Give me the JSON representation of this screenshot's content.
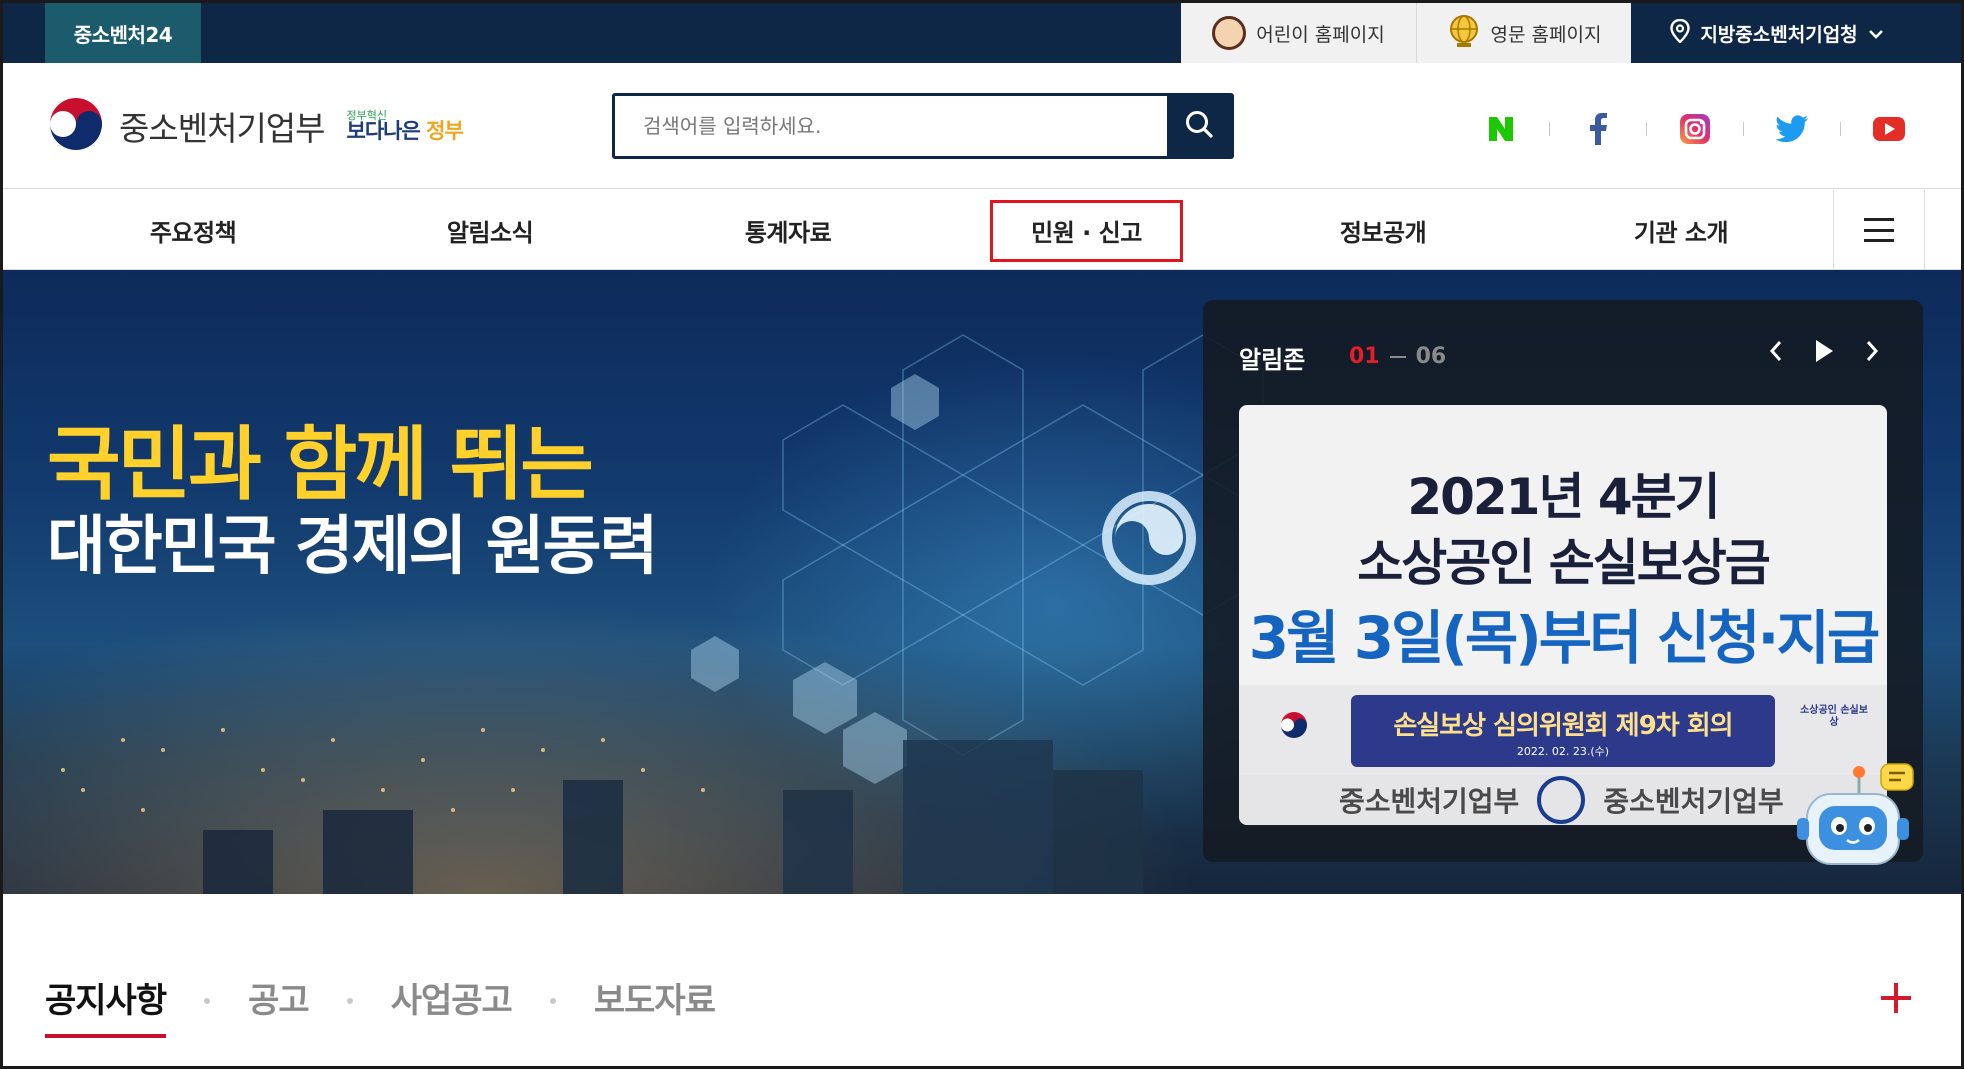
{
  "topbar": {
    "site_label": "중소벤처24",
    "kids_label": "어린이 홈페이지",
    "english_label": "영문 홈페이지",
    "regional_label": "지방중소벤처기업청"
  },
  "header": {
    "ministry_name": "중소벤처기업부",
    "slogan_small": "정부혁신",
    "slogan_large_a": "보다나은",
    "slogan_large_b": "정부",
    "search_placeholder": "검색어를 입력하세요.",
    "sns": [
      "naver-icon",
      "facebook-icon",
      "instagram-icon",
      "twitter-icon",
      "youtube-icon"
    ]
  },
  "nav": {
    "items": [
      "주요정책",
      "알림소식",
      "통계자료",
      "민원 · 신고",
      "정보공개",
      "기관 소개"
    ]
  },
  "hero": {
    "tagline_line1": "국민과 함께 뛰는",
    "tagline_line2": "대한민국 경제의 원동력"
  },
  "notice_zone": {
    "title": "알림존",
    "current": "01",
    "total": "06",
    "card": {
      "line1": "2021년 4분기",
      "line2": "소상공인 손실보상금",
      "line3": "3월 3일(목)부터 신청·지급",
      "banner_title": "손실보상 심의위원회 제9차 회의",
      "banner_date": "2022. 02. 23.(수)",
      "banner_side_logo": "소상공인 손실보상",
      "footer_text_left": "중소벤처기업부",
      "footer_text_right": "중소벤처기업부"
    }
  },
  "tabs": {
    "items": [
      "공지사항",
      "공고",
      "사업공고",
      "보도자료"
    ],
    "active_index": 0
  },
  "colors": {
    "navy": "#0f2746",
    "accent_red": "#e0151f",
    "tagline_yellow": "#ffd12a",
    "card_blue": "#1565c0"
  }
}
